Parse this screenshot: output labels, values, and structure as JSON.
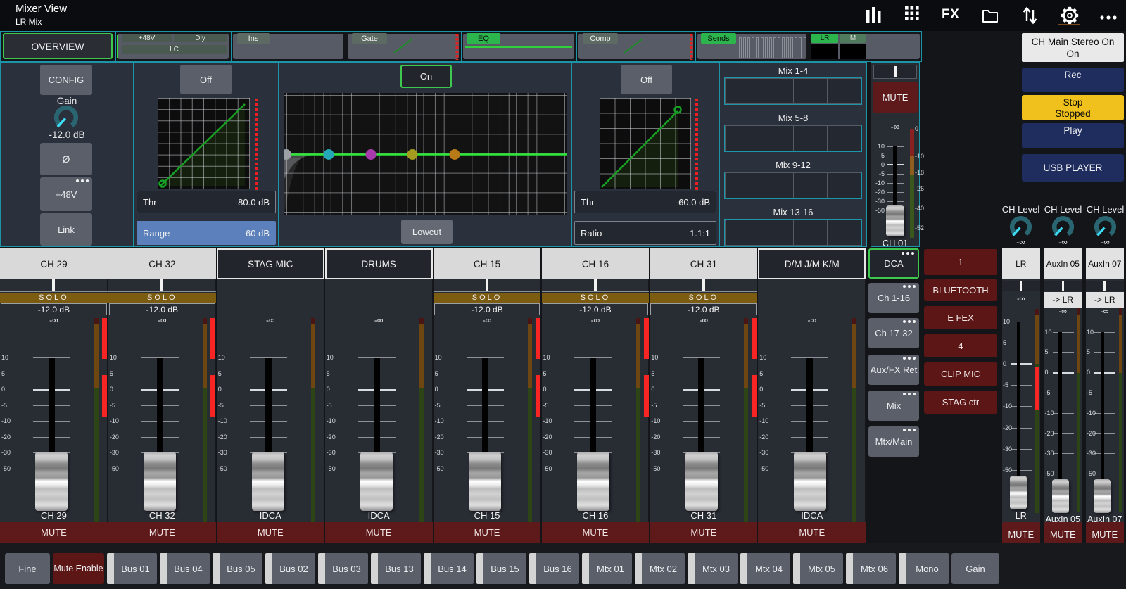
{
  "title_bar": {
    "title": "Mixer View",
    "subtitle": "LR Mix",
    "fx_label": "FX",
    "icons": [
      "meters-icon",
      "grid-icon",
      "fx-icon",
      "folder-icon",
      "transfer-icon",
      "gear-icon",
      "more-icon"
    ]
  },
  "overview": {
    "overview_label": "OVERVIEW",
    "input_buttons": [
      "+48V",
      "Dly",
      "LC"
    ],
    "ins_label": "Ins",
    "gate_label": "Gate",
    "eq_label": "EQ",
    "comp_label": "Comp",
    "sends_label": "Sends",
    "sends_bar_count": 16,
    "main_lr_label": "LR",
    "main_m_label": "M"
  },
  "config_panel": {
    "config_label": "CONFIG",
    "gain_label": "Gain",
    "gain_value": "-12.0 dB",
    "phase_label": "Ø",
    "phantom_label": "+48V",
    "link_label": "Link"
  },
  "gate_panel": {
    "state_label": "Off",
    "thr_label": "Thr",
    "thr_value": "-80.0 dB",
    "range_label": "Range",
    "range_value": "60 dB"
  },
  "eq_panel": {
    "state_label": "On",
    "lowcut_label": "Lowcut",
    "band_colors": [
      "#9aa0a6",
      "#25a8b8",
      "#a93aab",
      "#a39c1f",
      "#b87a16"
    ]
  },
  "comp_panel": {
    "state_label": "Off",
    "thr_label": "Thr",
    "thr_value": "-60.0 dB",
    "ratio_label": "Ratio",
    "ratio_value": "1.1:1"
  },
  "sends_panel": {
    "groups": [
      "Mix 1-4",
      "Mix 5-8",
      "Mix 9-12",
      "Mix 13-16"
    ],
    "slots_per_group": 4
  },
  "main_strip": {
    "mute_label": "MUTE",
    "value": "-∞",
    "label": "CH 01",
    "fader_scale": [
      "10",
      "5",
      "0",
      "-5",
      "-10",
      "-20",
      "-30",
      "-50"
    ],
    "meter_scale": [
      "0",
      "-10",
      "-18",
      "-26",
      "-40",
      "-52"
    ]
  },
  "transport": {
    "main_line1": "CH Main Stereo On",
    "main_line2": "On",
    "rec_label": "Rec",
    "stop_line1": "Stop",
    "stop_line2": "Stopped",
    "play_label": "Play",
    "usb_label": "USB PLAYER"
  },
  "ch_level_knobs": {
    "label": "CH Level",
    "value": "-∞",
    "count": 3
  },
  "channel_strips": [
    {
      "name": "CH 29",
      "type": "channel",
      "solo": "SOLO",
      "gain": "-12.0 dB",
      "value": "-∞",
      "label": "CH 29",
      "mute": "MUTE",
      "lit": true
    },
    {
      "name": "CH 32",
      "type": "channel",
      "solo": "SOLO",
      "gain": "-12.0 dB",
      "value": "-∞",
      "label": "CH 32",
      "mute": "MUTE",
      "lit": true
    },
    {
      "name": "STAG MIC",
      "type": "dca",
      "value": "-∞",
      "label": "IDCA",
      "mute": "MUTE",
      "lit": false
    },
    {
      "name": "DRUMS",
      "type": "dca",
      "value": "-∞",
      "label": "IDCA",
      "mute": "MUTE",
      "lit": false
    },
    {
      "name": "CH 15",
      "type": "channel",
      "solo": "SOLO",
      "gain": "-12.0 dB",
      "value": "-∞",
      "label": "CH 15",
      "mute": "MUTE",
      "lit": true
    },
    {
      "name": "CH 16",
      "type": "channel",
      "solo": "SOLO",
      "gain": "-12.0 dB",
      "value": "-∞",
      "label": "CH 16",
      "mute": "MUTE",
      "lit": true
    },
    {
      "name": "CH 31",
      "type": "channel",
      "solo": "SOLO",
      "gain": "-12.0 dB",
      "value": "-∞",
      "label": "CH 31",
      "mute": "MUTE",
      "lit": true
    },
    {
      "name": "D/M J/M K/M",
      "type": "dca",
      "value": "-∞",
      "label": "IDCA",
      "mute": "MUTE",
      "lit": false
    }
  ],
  "fader_scale": [
    "10",
    "5",
    "0",
    "-5",
    "-10",
    "-20",
    "-30",
    "-50"
  ],
  "layer_buttons": [
    {
      "label": "DCA",
      "selected": true
    },
    {
      "label": "Ch 1-16",
      "selected": false
    },
    {
      "label": "Ch 17-32",
      "selected": false
    },
    {
      "label": "Aux/FX Ret",
      "selected": false
    },
    {
      "label": "Mix",
      "selected": false
    },
    {
      "label": "Mtx/Main",
      "selected": false
    }
  ],
  "dca_groups": [
    "1",
    "BLUETOOTH",
    "E FEX",
    "4",
    "CLIP MIC",
    "STAG ctr"
  ],
  "right_strips": [
    {
      "name": "LR",
      "routing": null,
      "value": "-∞",
      "label": "LR",
      "mute": "MUTE",
      "lit": true
    },
    {
      "name": "AuxIn 05",
      "routing": "-> LR",
      "value": "-∞",
      "label": "AuxIn 05",
      "mute": "MUTE",
      "lit": false
    },
    {
      "name": "AuxIn 07",
      "routing": "-> LR",
      "value": "-∞",
      "label": "AuxIn 07",
      "mute": "MUTE",
      "lit": false
    }
  ],
  "toolbar": {
    "fine_label": "Fine",
    "mute_enable_label": "Mute Enable",
    "tabs": [
      "Bus 01",
      "Bus 04",
      "Bus 05",
      "Bus 02",
      "Bus 03",
      "Bus 13",
      "Bus 14",
      "Bus 15",
      "Bus 16",
      "Mtx 01",
      "Mtx 02",
      "Mtx 03",
      "Mtx 04",
      "Mtx 05",
      "Mtx 06",
      "Mono"
    ],
    "gain_label": "Gain"
  },
  "colors": {
    "accent_cyan": "#1d95a8",
    "accent_green": "#3fc84f",
    "bright_green": "#2fd23a",
    "chip_green": "#2cb44d",
    "chip_gray_green": "#5d6a63",
    "mute_red": "#5e1a1a",
    "dca_red": "#5c1616",
    "solo_olive": "#7c5c10",
    "range_blue": "#5b80bc",
    "navy": "#1e2c5e",
    "yellow": "#f0c11d",
    "knob_ring": "#2a6671",
    "knob_pointer": "#3ddcf5",
    "meter_red_lit": "#f82525",
    "meter_red_dark": "#4a1515",
    "meter_orange_dark": "#6e4612",
    "meter_green_dark": "#2c4416"
  }
}
